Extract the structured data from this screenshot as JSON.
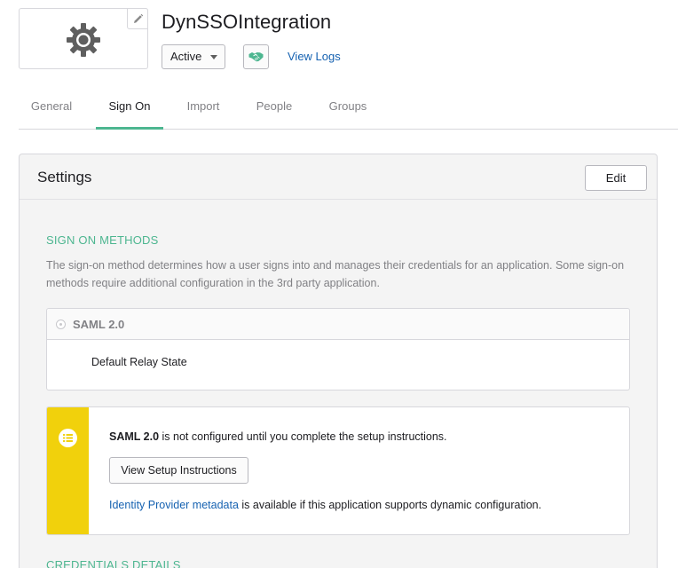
{
  "app": {
    "title": "DynSSOIntegration",
    "logo_icon": "gear-icon",
    "edit_icon": "pencil-icon"
  },
  "status": {
    "selected": "Active"
  },
  "actions": {
    "push_icon": "handshake-icon",
    "view_logs": "View Logs"
  },
  "tabs": [
    {
      "label": "General",
      "active": false
    },
    {
      "label": "Sign On",
      "active": true
    },
    {
      "label": "Import",
      "active": false
    },
    {
      "label": "People",
      "active": false
    },
    {
      "label": "Groups",
      "active": false
    }
  ],
  "settings": {
    "title": "Settings",
    "edit_label": "Edit",
    "sign_on_methods": {
      "heading": "SIGN ON METHODS",
      "description": "The sign-on method determines how a user signs into and manages their credentials for an application. Some sign-on methods require additional configuration in the 3rd party application."
    },
    "saml": {
      "label": "SAML 2.0",
      "relay_state_label": "Default Relay State"
    },
    "callout": {
      "icon": "list-icon",
      "bold": "SAML 2.0",
      "message": " is not configured until you complete the setup instructions.",
      "button": "View Setup Instructions",
      "link": "Identity Provider metadata",
      "link_suffix": " is available if this application supports dynamic configuration."
    },
    "credentials": {
      "heading": "CREDENTIALS DETAILS"
    }
  },
  "colors": {
    "accent_green": "#4db690",
    "link_blue": "#1662b1",
    "callout_yellow": "#f1d10c"
  }
}
